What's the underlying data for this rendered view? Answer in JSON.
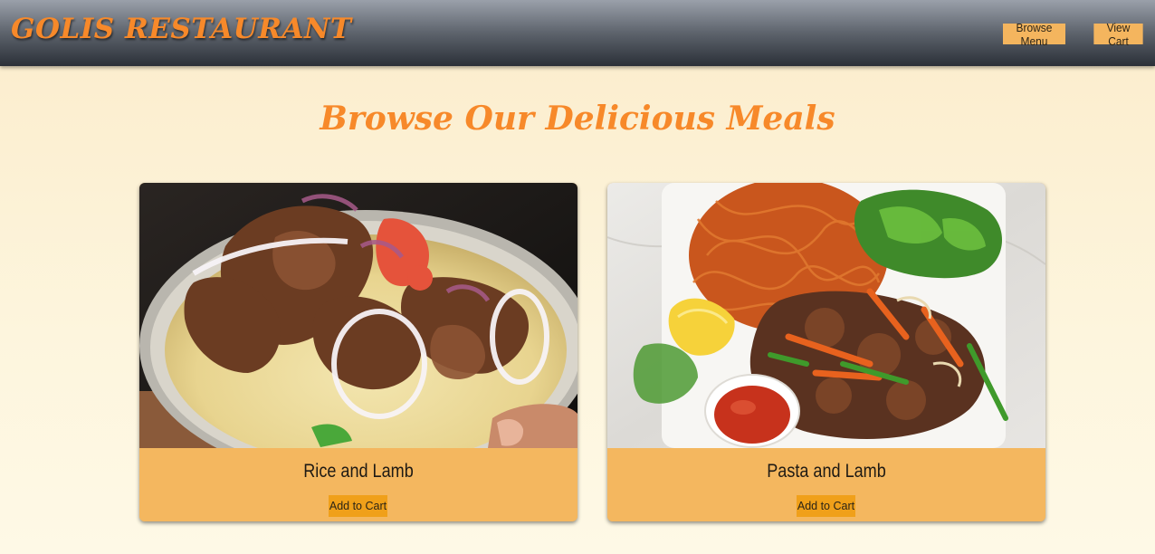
{
  "header": {
    "brand": "GOLIS RESTAURANT",
    "nav": [
      {
        "label": "Browse Menu"
      },
      {
        "label": "View Cart"
      }
    ]
  },
  "main": {
    "title": "Browse Our Delicious Meals",
    "meals": [
      {
        "name": "Rice and Lamb",
        "button_label": "Add to Cart"
      },
      {
        "name": "Pasta and Lamb",
        "button_label": "Add to Cart"
      }
    ]
  },
  "colors": {
    "accent": "#f7892a",
    "card_bg": "#f4b75f",
    "button": "#f0a01a",
    "nav_button": "#f4b55e"
  }
}
